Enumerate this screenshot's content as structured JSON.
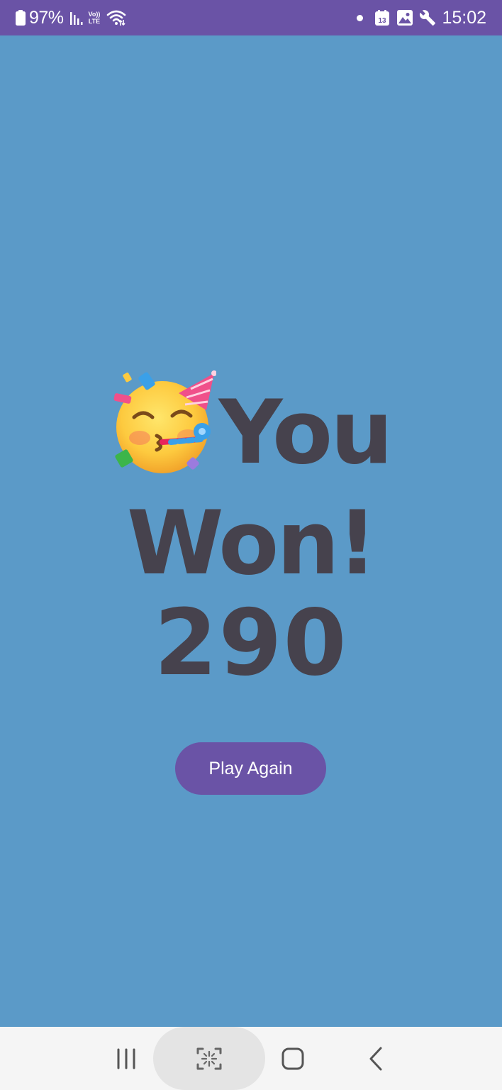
{
  "status_bar": {
    "battery": "97%",
    "volte_top": "Vo))",
    "volte_bottom": "LTE",
    "calendar_day": "13",
    "time": "15:02",
    "icons": [
      "battery-icon",
      "signal-icon",
      "volte-icon",
      "wifi-icon",
      "dot-icon",
      "calendar-icon",
      "image-icon",
      "wrench-icon"
    ]
  },
  "main": {
    "emoji": "partying-face-icon",
    "title": "You Won!",
    "score": "290",
    "play_again_label": "Play Again"
  },
  "nav_bar": {
    "icons": [
      "recent-apps-icon",
      "home-icon",
      "assistant-icon",
      "back-icon"
    ]
  },
  "colors": {
    "background": "#5b9ac8",
    "status_bar": "#6a53a6",
    "button": "#6a53a6",
    "text": "#46424d",
    "nav_bar": "#f5f5f5"
  }
}
